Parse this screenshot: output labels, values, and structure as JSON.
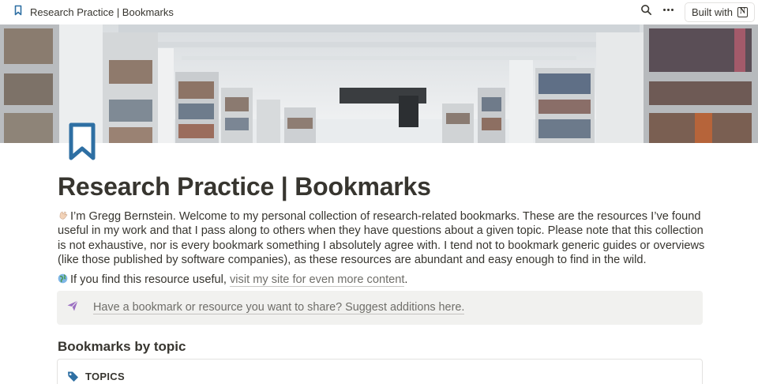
{
  "topbar": {
    "title": "Research Practice | Bookmarks",
    "built_with_label": "Built with",
    "icons": [
      "bookmark-icon",
      "search-icon",
      "more-icon",
      "notion-logo-icon"
    ]
  },
  "cover": {
    "image": "library-bookshelves"
  },
  "page": {
    "icon": "bookmark-icon",
    "title": "Research Practice | Bookmarks",
    "intro": "I’m Gregg Bernstein. Welcome to my personal collection of research-related bookmarks. These are the resources I’ve found useful in my work and that I pass along to others when they have questions about a given topic. Please note that this collection is not exhaustive, nor is every bookmark something I absolutely agree with. I tend not to bookmark generic guides or overviews (like those published by software companies), as these resources are abundant and easy enough to find in the wild.",
    "resource_prefix": "If you find this resource useful,",
    "resource_link": "visit my site for even more content",
    "resource_suffix": "."
  },
  "callout": {
    "icon": "paper-plane-icon",
    "text": "Have a bookmark or resource you want to share? Suggest additions here."
  },
  "section": {
    "heading": "Bookmarks by topic"
  },
  "database": {
    "icon": "tag-icon",
    "title": "TOPICS"
  },
  "colors": {
    "text": "#37352f",
    "muted": "#6f6e69",
    "accent_blue": "#2e6fa3",
    "callout_bg": "#f1f1ef",
    "purple": "#9b6fc2"
  }
}
